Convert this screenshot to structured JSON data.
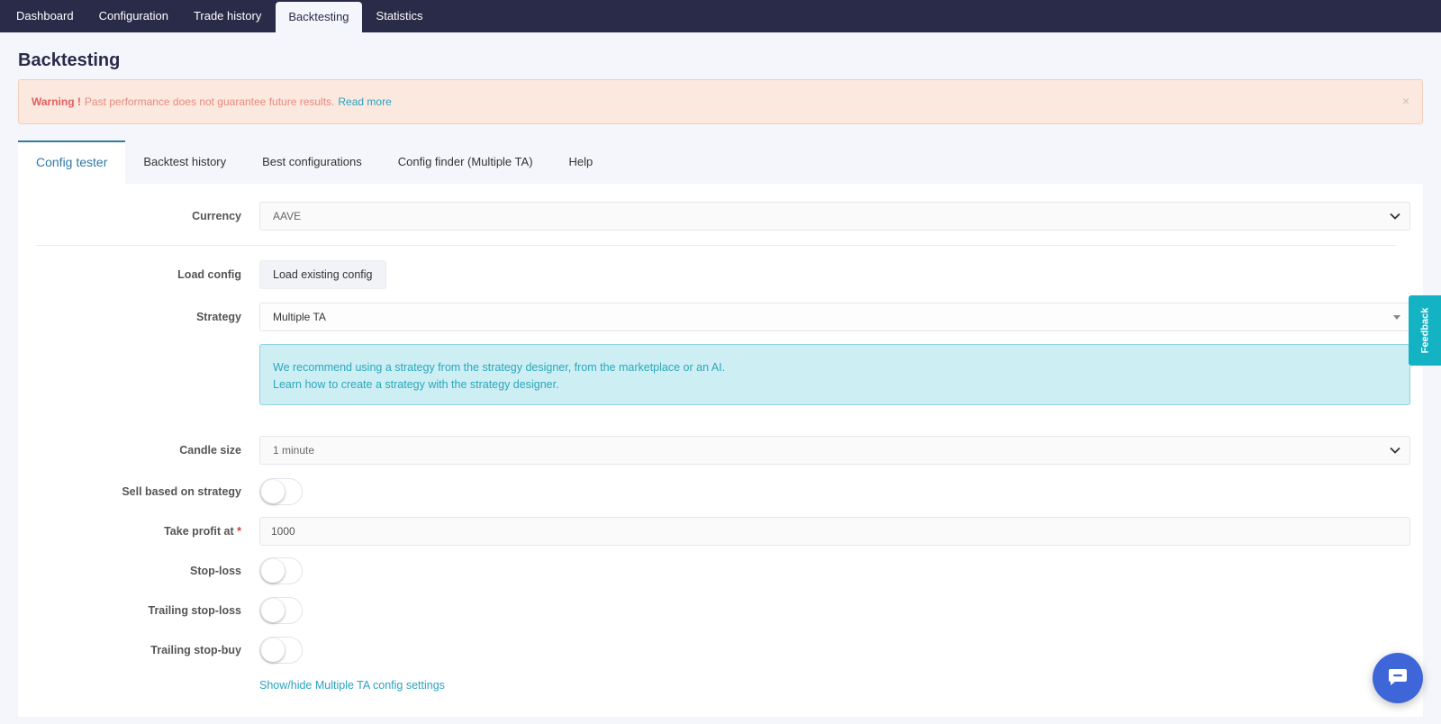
{
  "topnav": {
    "tabs": [
      {
        "label": "Dashboard"
      },
      {
        "label": "Configuration"
      },
      {
        "label": "Trade history"
      },
      {
        "label": "Backtesting",
        "active": true
      },
      {
        "label": "Statistics"
      }
    ]
  },
  "page": {
    "title": "Backtesting"
  },
  "warning": {
    "strong": "Warning !",
    "text": "Past performance does not guarantee future results.",
    "link": "Read more",
    "close": "×"
  },
  "subtabs": [
    {
      "label": "Config tester",
      "active": true
    },
    {
      "label": "Backtest history"
    },
    {
      "label": "Best configurations"
    },
    {
      "label": "Config finder (Multiple TA)"
    },
    {
      "label": "Help"
    }
  ],
  "form": {
    "currency": {
      "label": "Currency",
      "value": "AAVE"
    },
    "load_config": {
      "label": "Load config",
      "button": "Load existing config"
    },
    "strategy": {
      "label": "Strategy",
      "value": "Multiple TA"
    },
    "info": {
      "line1": "We recommend using a strategy from the strategy designer, from the marketplace or an AI.",
      "line2": "Learn how to create a strategy with the strategy designer."
    },
    "candle_size": {
      "label": "Candle size",
      "value": "1 minute"
    },
    "sell_based": {
      "label": "Sell based on strategy",
      "checked": false
    },
    "take_profit": {
      "label": "Take profit at",
      "required_mark": "*",
      "value": "1000"
    },
    "stop_loss": {
      "label": "Stop-loss",
      "checked": false
    },
    "trailing_stop_loss": {
      "label": "Trailing stop-loss",
      "checked": false
    },
    "trailing_stop_buy": {
      "label": "Trailing stop-buy",
      "checked": false
    },
    "show_hide_link": "Show/hide Multiple TA config settings"
  },
  "feedback": {
    "label": "Feedback"
  },
  "icons": {
    "chevron": "chevron-down-icon",
    "chat": "chat-bubble-icon",
    "close": "close-icon"
  },
  "colors": {
    "nav_bg": "#2a2a49",
    "accent": "#2f7aa6",
    "link": "#2aa3c3",
    "warning_bg": "#fbe8de",
    "info_bg": "#cdeff3",
    "feedback_bg": "#14b3c4",
    "chat_bg": "#3f66d9"
  }
}
